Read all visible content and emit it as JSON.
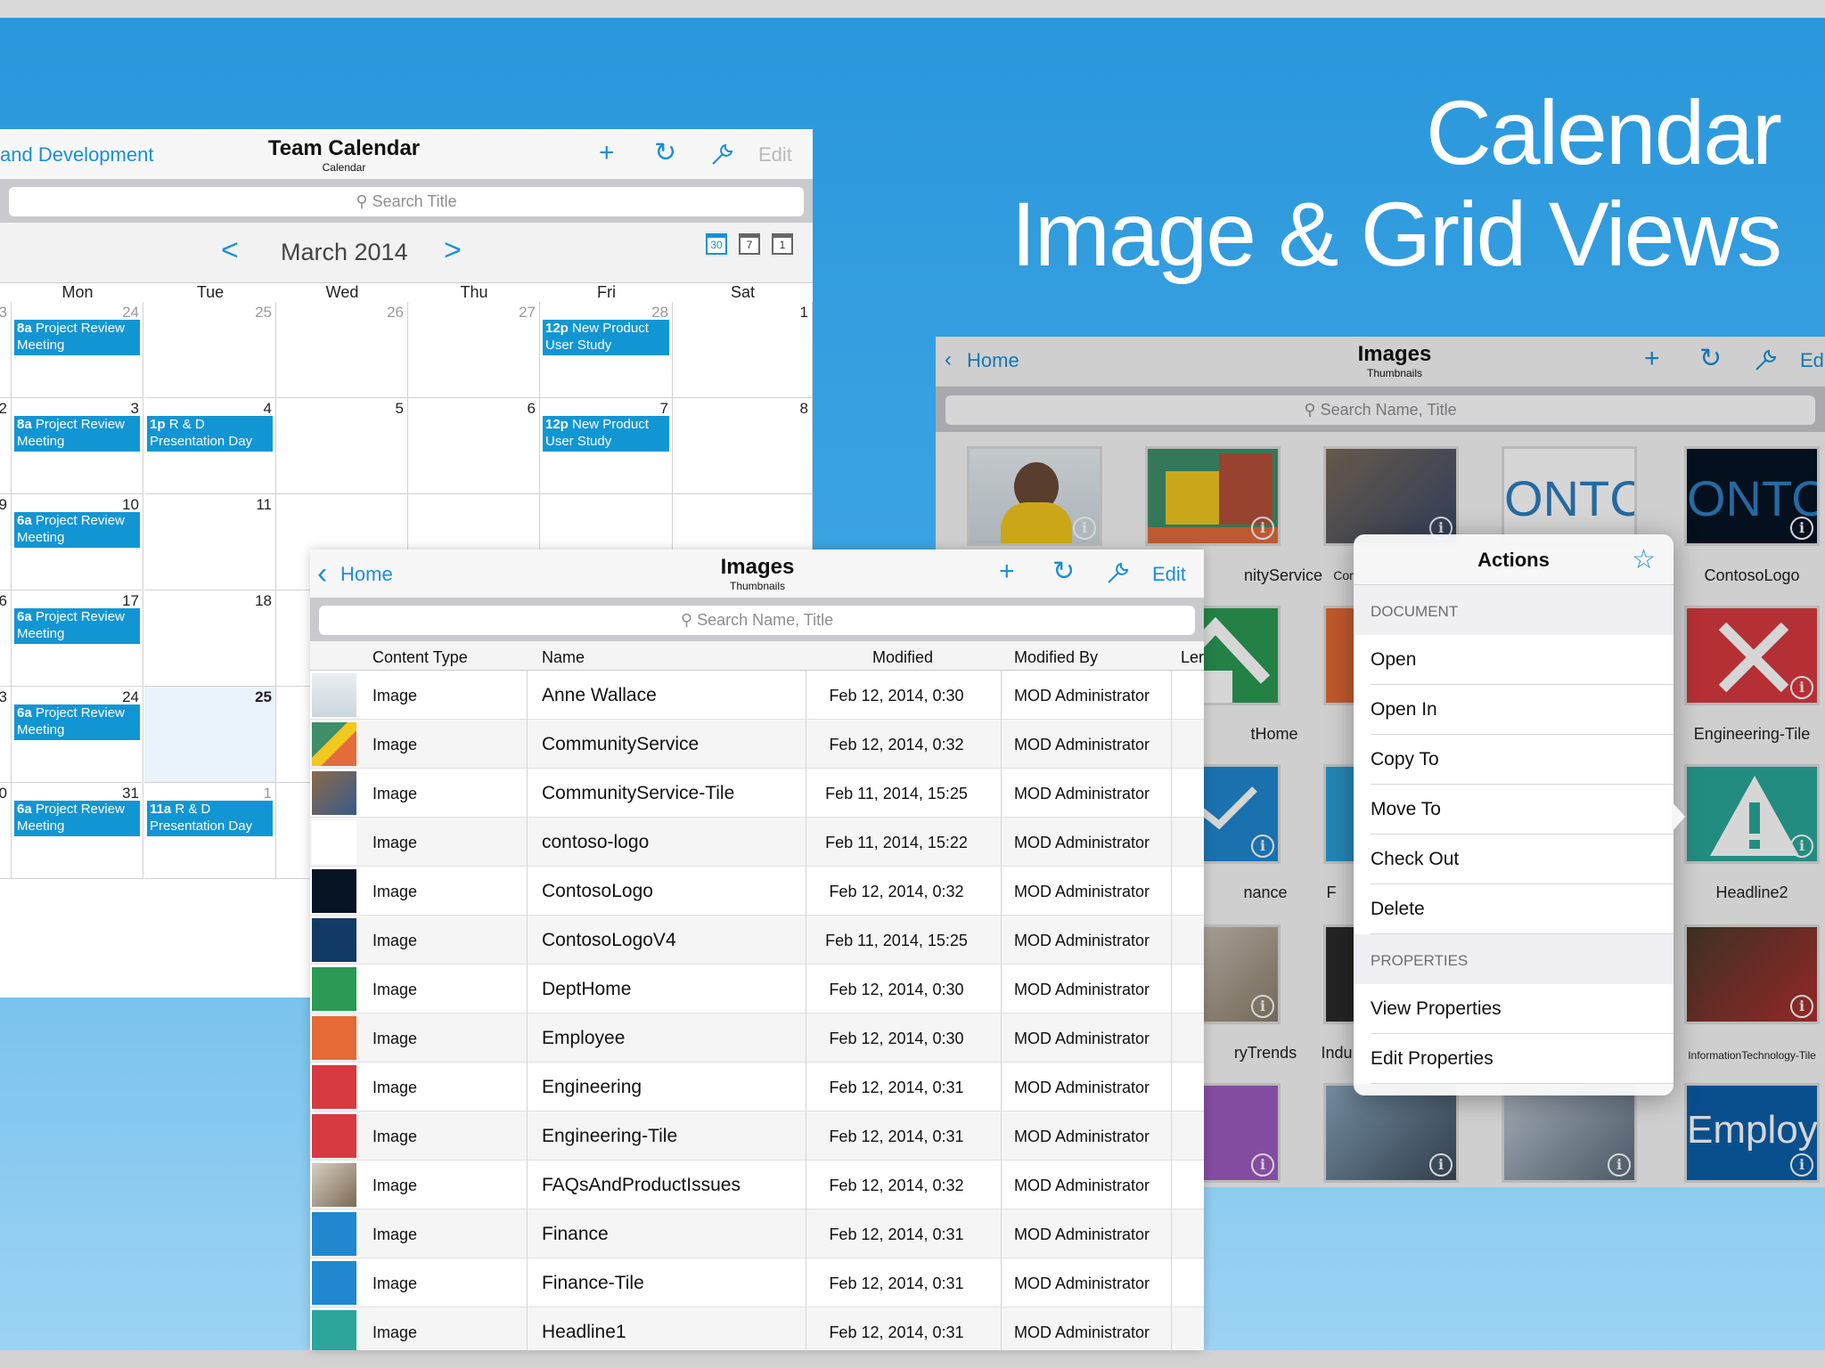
{
  "headline": {
    "line1": "Calendar",
    "line2": "Image & Grid Views"
  },
  "calendar": {
    "back_label": "and Development",
    "title": "Team Calendar",
    "subtitle": "Calendar",
    "edit_label": "Edit",
    "search_placeholder": "Search Title",
    "month": "March 2014",
    "prev_arrow": "<",
    "next_arrow": ">",
    "view_toggles": [
      "30",
      "7",
      "1"
    ],
    "day_names": [
      "Mon",
      "Tue",
      "Wed",
      "Thu",
      "Fri",
      "Sat"
    ],
    "weeks": [
      {
        "lead": "3",
        "days": [
          {
            "num": "24",
            "other": true,
            "event": {
              "time": "8a",
              "text": "Project Review Meeting"
            }
          },
          {
            "num": "25",
            "other": true
          },
          {
            "num": "26",
            "other": true
          },
          {
            "num": "27",
            "other": true
          },
          {
            "num": "28",
            "other": true,
            "event": {
              "time": "12p",
              "text": "New Product User Study"
            }
          },
          {
            "num": "1"
          }
        ]
      },
      {
        "lead": "2",
        "days": [
          {
            "num": "3",
            "event": {
              "time": "8a",
              "text": "Project Review Meeting"
            }
          },
          {
            "num": "4",
            "event": {
              "time": "1p",
              "text": "R & D Presentation Day"
            }
          },
          {
            "num": "5"
          },
          {
            "num": "6"
          },
          {
            "num": "7",
            "event": {
              "time": "12p",
              "text": "New Product User Study"
            }
          },
          {
            "num": "8"
          }
        ]
      },
      {
        "lead": "9",
        "days": [
          {
            "num": "10",
            "event": {
              "time": "6a",
              "text": "Project Review Meeting"
            }
          },
          {
            "num": "11"
          },
          {
            "num": ""
          },
          {
            "num": ""
          },
          {
            "num": ""
          },
          {
            "num": ""
          }
        ]
      },
      {
        "lead": "6",
        "days": [
          {
            "num": "17",
            "event": {
              "time": "6a",
              "text": "Project Review Meeting"
            }
          },
          {
            "num": "18"
          },
          {
            "num": ""
          },
          {
            "num": ""
          },
          {
            "num": ""
          },
          {
            "num": ""
          }
        ]
      },
      {
        "lead": "3",
        "days": [
          {
            "num": "24",
            "event": {
              "time": "6a",
              "text": "Project Review Meeting"
            }
          },
          {
            "num": "25",
            "today": true
          },
          {
            "num": ""
          },
          {
            "num": ""
          },
          {
            "num": ""
          },
          {
            "num": ""
          }
        ]
      },
      {
        "lead": "0",
        "days": [
          {
            "num": "31",
            "event": {
              "time": "6a",
              "text": "Project Review Meeting"
            }
          },
          {
            "num": "1",
            "other": true,
            "event": {
              "time": "11a",
              "text": "R & D Presentation Day"
            }
          },
          {
            "num": ""
          },
          {
            "num": ""
          },
          {
            "num": ""
          },
          {
            "num": ""
          }
        ]
      }
    ]
  },
  "images_grid": {
    "back_label": "Home",
    "title": "Images",
    "subtitle": "Thumbnails",
    "edit_label": "Ed",
    "search_placeholder": "Search Name, Title",
    "tile_labels": [
      {
        "text": "nityService"
      },
      {
        "text": "Com"
      },
      {
        "text": "ContosoLogo"
      },
      {
        "text": "tHome"
      },
      {
        "text": "Engineering-Tile"
      },
      {
        "text": "nance"
      },
      {
        "text": "F"
      },
      {
        "text": "Headline2"
      },
      {
        "text": "ryTrends"
      },
      {
        "text": "Indu"
      },
      {
        "text": "InformationTechnology-Tile"
      }
    ],
    "tile_texts": {
      "contoso": "ONTC",
      "contoso2": "ONTO",
      "employee": "Employe"
    }
  },
  "actions": {
    "title": "Actions",
    "section_document": "DOCUMENT",
    "document_items": [
      "Open",
      "Open In",
      "Copy To",
      "Move To",
      "Check Out",
      "Delete"
    ],
    "section_properties": "PROPERTIES",
    "property_items": [
      "View Properties",
      "Edit Properties"
    ]
  },
  "images_table": {
    "back_label": "Home",
    "title": "Images",
    "subtitle": "Thumbnails",
    "edit_label": "Edit",
    "search_placeholder": "Search Name, Title",
    "columns": [
      "Content Type",
      "Name",
      "Modified",
      "Modified By",
      "Ler"
    ],
    "rows": [
      {
        "type": "Image",
        "name": "Anne Wallace",
        "modified": "Feb 12, 2014, 0:30",
        "by": "MOD Administrator",
        "thumb": "person"
      },
      {
        "type": "Image",
        "name": "CommunityService",
        "modified": "Feb 12, 2014, 0:32",
        "by": "MOD Administrator",
        "thumb": "kids"
      },
      {
        "type": "Image",
        "name": "CommunityService-Tile",
        "modified": "Feb 11, 2014, 15:25",
        "by": "MOD Administrator",
        "thumb": "group"
      },
      {
        "type": "Image",
        "name": "contoso-logo",
        "modified": "Feb 11, 2014, 15:22",
        "by": "MOD Administrator",
        "thumb": "logo-white"
      },
      {
        "type": "Image",
        "name": "ContosoLogo",
        "modified": "Feb 12, 2014, 0:32",
        "by": "MOD Administrator",
        "thumb": "logo-dark"
      },
      {
        "type": "Image",
        "name": "ContosoLogoV4",
        "modified": "Feb 11, 2014, 15:25",
        "by": "MOD Administrator",
        "thumb": "logo-blue"
      },
      {
        "type": "Image",
        "name": "DeptHome",
        "modified": "Feb 12, 2014, 0:30",
        "by": "MOD Administrator",
        "thumb": "home"
      },
      {
        "type": "Image",
        "name": "Employee",
        "modified": "Feb 12, 2014, 0:30",
        "by": "MOD Administrator",
        "thumb": "employee"
      },
      {
        "type": "Image",
        "name": "Engineering",
        "modified": "Feb 12, 2014, 0:31",
        "by": "MOD Administrator",
        "thumb": "tools"
      },
      {
        "type": "Image",
        "name": "Engineering-Tile",
        "modified": "Feb 12, 2014, 0:31",
        "by": "MOD Administrator",
        "thumb": "tools"
      },
      {
        "type": "Image",
        "name": "FAQsAndProductIssues",
        "modified": "Feb 12, 2014, 0:32",
        "by": "MOD Administrator",
        "thumb": "faq"
      },
      {
        "type": "Image",
        "name": "Finance",
        "modified": "Feb 12, 2014, 0:31",
        "by": "MOD Administrator",
        "thumb": "finance"
      },
      {
        "type": "Image",
        "name": "Finance-Tile",
        "modified": "Feb 12, 2014, 0:31",
        "by": "MOD Administrator",
        "thumb": "finance"
      },
      {
        "type": "Image",
        "name": "Headline1",
        "modified": "Feb 12, 2014, 0:31",
        "by": "MOD Administrator",
        "thumb": "headline"
      }
    ]
  },
  "colors": {
    "accent": "#1a8fd6",
    "event": "#1196d3",
    "background": "#2a97dc"
  }
}
